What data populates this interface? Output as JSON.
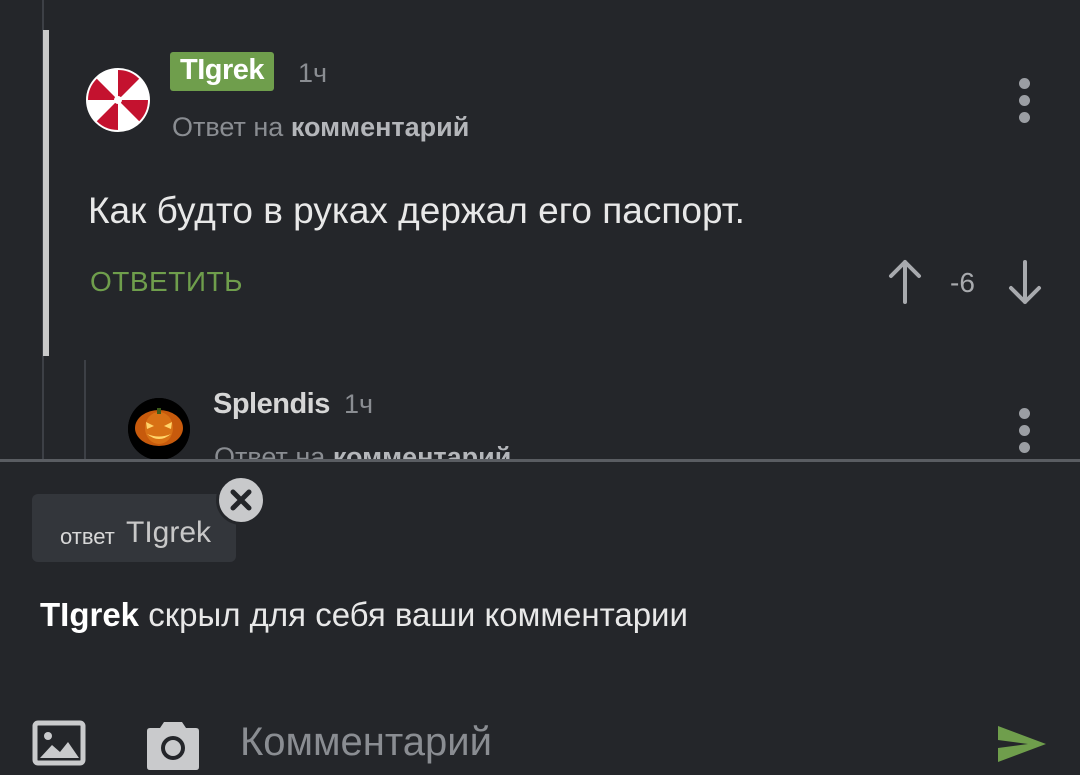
{
  "comments": [
    {
      "username": "TIgrek",
      "time": "1ч",
      "reply_prefix": "Ответ на",
      "reply_link": "комментарий",
      "text": "Как будто в руках держал его паспорт.",
      "reply_button": "ОТВЕТИТЬ",
      "rating": "-6",
      "avatar_icon": "umbrella-logo-icon"
    },
    {
      "username": "Splendis",
      "time": "1ч",
      "reply_prefix": "Ответ на",
      "reply_link": "комментарий",
      "avatar_icon": "jack-o-lantern-icon"
    }
  ],
  "compose": {
    "chip_prefix": "ответ",
    "chip_name": "TIgrek",
    "notice_user": "TIgrek",
    "notice_text": " скрыл для себя ваши комментарии",
    "input_placeholder": "Комментарий",
    "image_icon": "image-icon",
    "camera_icon": "camera-icon",
    "send_icon": "send-icon"
  },
  "colors": {
    "background": "#24262a",
    "accent_green": "#6f9e4c",
    "muted_text": "#8a8d92"
  }
}
